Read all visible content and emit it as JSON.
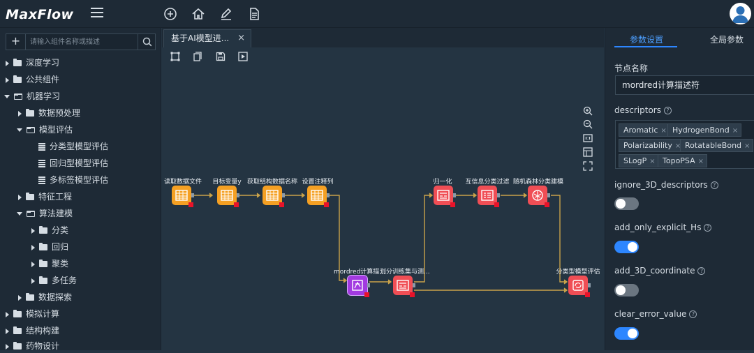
{
  "app": {
    "logo": "MaxFlow"
  },
  "sidebar": {
    "search_placeholder": "请输入组件名称或描述",
    "add_label": "+",
    "items": [
      {
        "label": "深度学习"
      },
      {
        "label": "公共组件"
      },
      {
        "label": "机器学习"
      },
      {
        "label": "数据预处理"
      },
      {
        "label": "模型评估"
      },
      {
        "label": "分类型模型评估"
      },
      {
        "label": "回归型模型评估"
      },
      {
        "label": "多标签模型评估"
      },
      {
        "label": "特征工程"
      },
      {
        "label": "算法建模"
      },
      {
        "label": "分类"
      },
      {
        "label": "回归"
      },
      {
        "label": "聚类"
      },
      {
        "label": "多任务"
      },
      {
        "label": "数据探索"
      },
      {
        "label": "模拟计算"
      },
      {
        "label": "结构构建"
      },
      {
        "label": "药物设计"
      }
    ]
  },
  "canvas": {
    "tab_title": "基于AI模型进...",
    "tab_close": "×",
    "nodes": [
      {
        "label": "读取数据文件",
        "color": "#f5a023"
      },
      {
        "label": "目标变量y",
        "color": "#f5a023"
      },
      {
        "label": "获取结构数据名称",
        "color": "#f5a023"
      },
      {
        "label": "设置注释列",
        "color": "#f5a023"
      },
      {
        "label": "mordred计算描...",
        "color": "#a23ae0"
      },
      {
        "label": "划分训练集与测...",
        "color": "#f04e55"
      },
      {
        "label": "归一化",
        "color": "#f04e55"
      },
      {
        "label": "互信息分类过滤",
        "color": "#f04e55"
      },
      {
        "label": "随机森林分类建模",
        "color": "#f04e55"
      },
      {
        "label": "分类型模型评估",
        "color": "#f04e55"
      }
    ]
  },
  "panel": {
    "tab_params": "参数设置",
    "tab_global": "全局参数",
    "node_name_label": "节点名称",
    "node_name_value": "mordred计算描述符",
    "descriptors_label": "descriptors",
    "help_glyph": "?",
    "tags": [
      "Aromatic",
      "HydrogenBond",
      "Polarizability",
      "RotatableBond",
      "SLogP",
      "TopoPSA"
    ],
    "tag_remove": "×",
    "options": [
      {
        "label": "ignore_3D_descriptors",
        "on": false
      },
      {
        "label": "add_only_explicit_Hs",
        "on": true
      },
      {
        "label": "add_3D_coordinate",
        "on": false
      },
      {
        "label": "clear_error_value",
        "on": true
      }
    ]
  },
  "colors": {
    "accent": "#2d86ff",
    "node_orange": "#f5a023",
    "node_red": "#f04e55",
    "node_purple": "#a23ae0",
    "edge": "#c9a24a"
  }
}
